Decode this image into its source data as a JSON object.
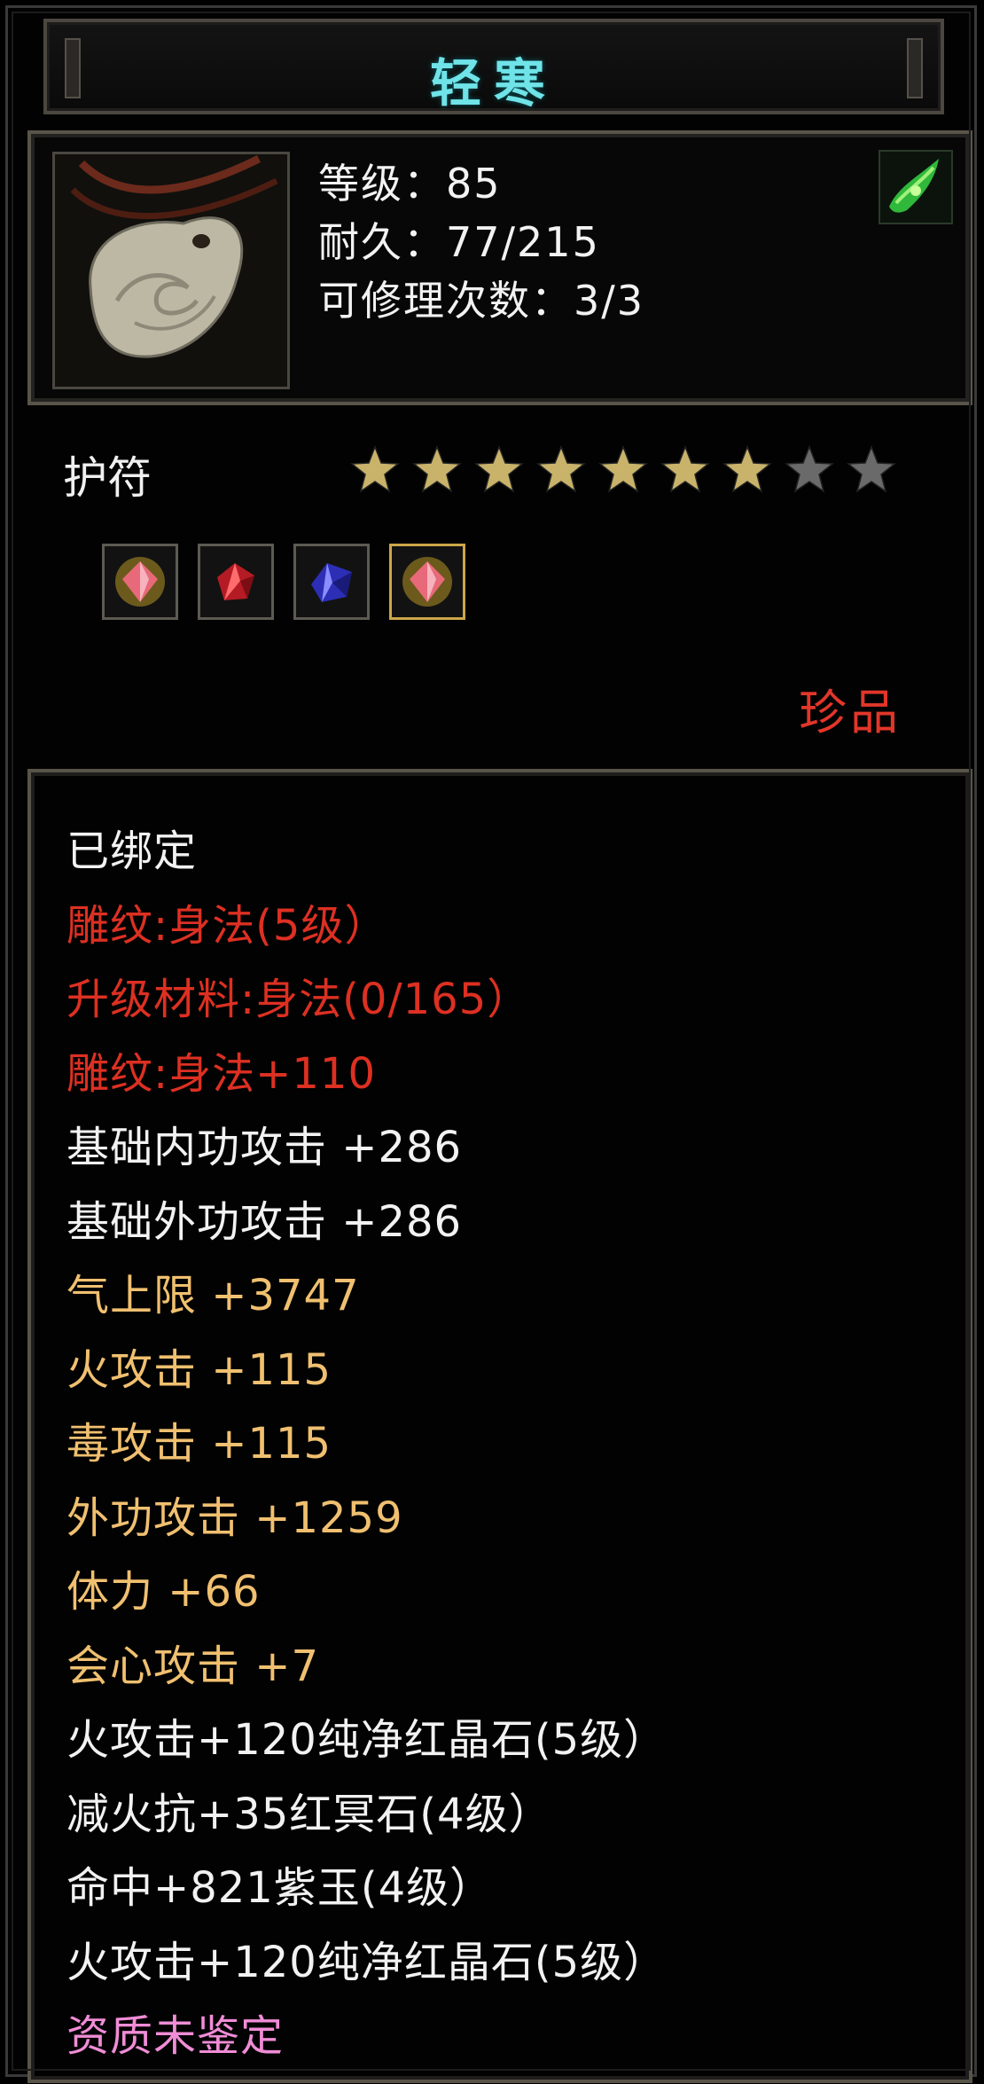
{
  "item": {
    "name": "轻寒",
    "level_line": "等级：85",
    "durability_line": "耐久：77/215",
    "repair_line": "可修理次数：3/3",
    "type": "护符",
    "stars_filled": 7,
    "stars_total": 9,
    "quality": "珍品",
    "gems": [
      "pink-crystal-icon",
      "red-crystal-icon",
      "blue-crystal-icon",
      "pink-crystal-icon"
    ],
    "badge_icon": "green-cloth-icon"
  },
  "colors": {
    "title": "#6fe3e8",
    "red": "#dd3022",
    "gold": "#f0c070",
    "white": "#f2f2f2",
    "pink": "#f08cd6",
    "star_gold": "#c9b36a",
    "star_gray": "#6a6a6a"
  },
  "attributes": {
    "bound": "已绑定",
    "engrave": "雕纹:身法(5级）",
    "upgrade_material": "升级材料:身法(0/165）",
    "engrave_bonus": "雕纹:身法+110",
    "base_inner_attack": "基础内功攻击  +286",
    "base_outer_attack": "基础外功攻击  +286",
    "qi_cap": "气上限  +3747",
    "fire_attack": "火攻击  +115",
    "poison_attack": "毒攻击  +115",
    "outer_attack": "外功攻击  +1259",
    "stamina": "体力  +66",
    "critical": "会心攻击  +7",
    "gem1": "火攻击+120纯净红晶石(5级）",
    "gem2": "减火抗+35红冥石(4级）",
    "gem3": "命中+821紫玉(4级）",
    "gem4": "火攻击+120纯净红晶石(5级）",
    "aptitude": "资质未鉴定"
  }
}
